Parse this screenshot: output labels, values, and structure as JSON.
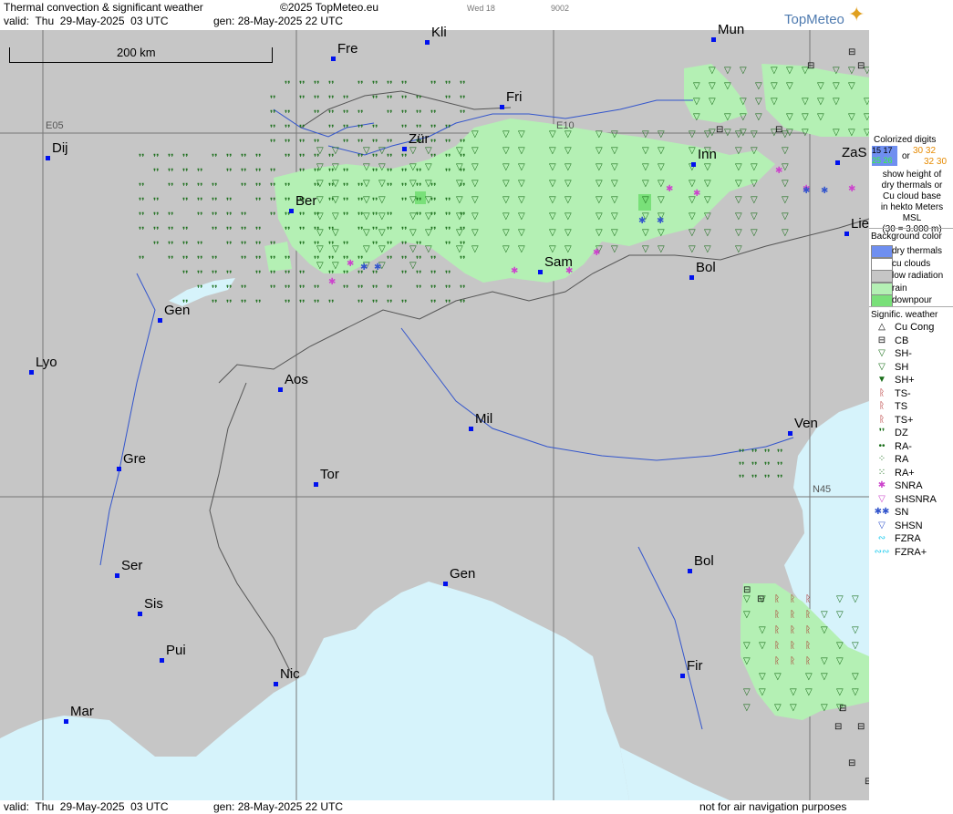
{
  "header": {
    "title": "Thermal convection & significant weather",
    "copyright": "©2025 TopMeteo.eu",
    "day_label": "Wed 18",
    "code_label": "9002",
    "valid": "valid:  Thu  29-May-2025  03 UTC",
    "gen": "gen: 28-May-2025 22 UTC",
    "logo": "TopMeteo"
  },
  "footer": {
    "valid": "valid:  Thu  29-May-2025  03 UTC",
    "gen": "gen: 28-May-2025 22 UTC",
    "note": "not for air navigation purposes"
  },
  "scale": {
    "label": "200 km"
  },
  "grid_labels": {
    "e05": "E05",
    "e10": "E10",
    "n45": "N45"
  },
  "cities": [
    {
      "name": "Kli"
    },
    {
      "name": "Mun"
    },
    {
      "name": "Fre"
    },
    {
      "name": "Fri"
    },
    {
      "name": "Dij"
    },
    {
      "name": "Zür"
    },
    {
      "name": "Inn"
    },
    {
      "name": "ZaS"
    },
    {
      "name": "Ber"
    },
    {
      "name": "Lie"
    },
    {
      "name": "Sam"
    },
    {
      "name": "Bol"
    },
    {
      "name": "Gen"
    },
    {
      "name": "Lyo"
    },
    {
      "name": "Aos"
    },
    {
      "name": "Mil"
    },
    {
      "name": "Ven"
    },
    {
      "name": "Gre"
    },
    {
      "name": "Tor"
    },
    {
      "name": "Ser"
    },
    {
      "name": "Gen"
    },
    {
      "name": "Bol"
    },
    {
      "name": "Sis"
    },
    {
      "name": "Pui"
    },
    {
      "name": "Nic"
    },
    {
      "name": "Fir"
    },
    {
      "name": "Mar"
    }
  ],
  "legend": {
    "digits_title": [
      "Colorized digits"
    ],
    "digits_or": "or",
    "digit_samples": [
      "15 17",
      "25 26",
      "30 32",
      "32 30"
    ],
    "digits_desc": [
      "show height of",
      "dry thermals or",
      "Cu cloud base",
      "in hekto Meters",
      "MSL",
      "(30 = 3.000 m)"
    ],
    "bg_title": "Background color",
    "bg_items": [
      {
        "label": "dry thermals",
        "color": "#6f8ff0"
      },
      {
        "label": "cu clouds",
        "color": "#ffffff"
      },
      {
        "label": "low radiation",
        "color": "#c6c6c6"
      },
      {
        "label": "rain",
        "color": "#b4f0b4"
      },
      {
        "label": "downpour",
        "color": "#79e079"
      }
    ],
    "sig_title": "Signific. weather",
    "sig_items": [
      {
        "label": "Cu Cong",
        "icon": "cu-cong-icon"
      },
      {
        "label": "CB",
        "icon": "cb-icon"
      },
      {
        "label": "SH-",
        "icon": "shower-light-icon"
      },
      {
        "label": "SH",
        "icon": "shower-icon"
      },
      {
        "label": "SH+",
        "icon": "shower-heavy-icon"
      },
      {
        "label": "TS-",
        "icon": "thunderstorm-light-icon"
      },
      {
        "label": "TS",
        "icon": "thunderstorm-icon"
      },
      {
        "label": "TS+",
        "icon": "thunderstorm-heavy-icon"
      },
      {
        "label": "DZ",
        "icon": "drizzle-icon"
      },
      {
        "label": "RA-",
        "icon": "rain-light-icon"
      },
      {
        "label": "RA",
        "icon": "rain-icon"
      },
      {
        "label": "RA+",
        "icon": "rain-heavy-icon"
      },
      {
        "label": "SNRA",
        "icon": "snow-rain-icon"
      },
      {
        "label": "SHSNRA",
        "icon": "snow-rain-shower-icon"
      },
      {
        "label": "SN",
        "icon": "snow-icon"
      },
      {
        "label": "SHSN",
        "icon": "snow-shower-icon"
      },
      {
        "label": "FZRA",
        "icon": "freezing-rain-icon"
      },
      {
        "label": "FZRA+",
        "icon": "freezing-rain-heavy-icon"
      }
    ]
  },
  "colors": {
    "land": "#c6c6c6",
    "sea": "#d6f3fb",
    "rain": "#b4f0b4",
    "downpour": "#79e079",
    "city_marker": "#0011ee",
    "symbol_green": "#1a6e1a",
    "symbol_snow": "#cc44cc",
    "symbol_ts": "#aa1111"
  }
}
